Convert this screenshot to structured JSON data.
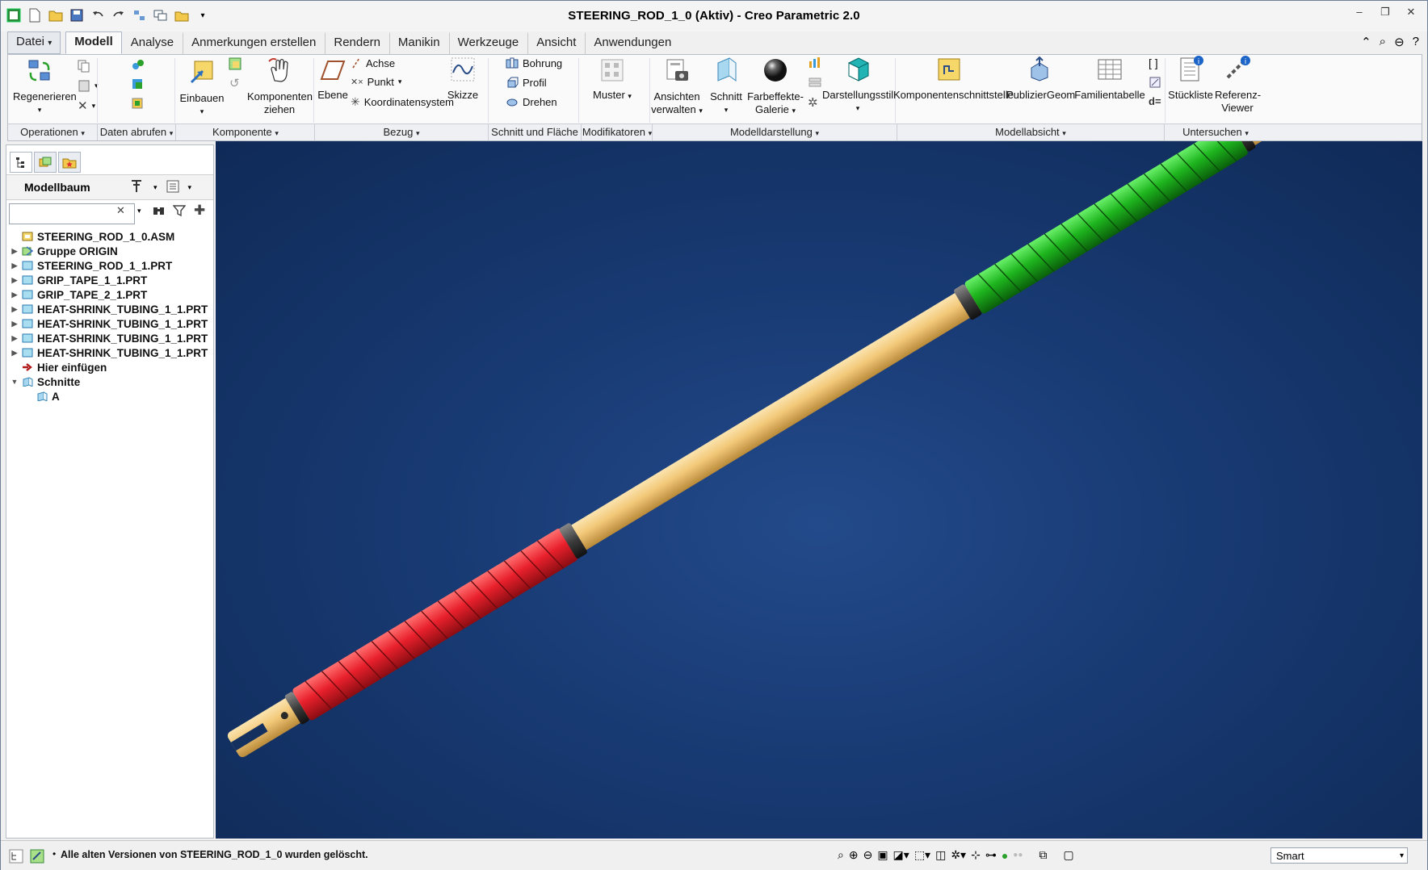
{
  "window": {
    "title": "STEERING_ROD_1_0 (Aktiv) - Creo Parametric 2.0"
  },
  "tabs": [
    {
      "label": "Datei"
    },
    {
      "label": "Modell"
    },
    {
      "label": "Analyse"
    },
    {
      "label": "Anmerkungen erstellen"
    },
    {
      "label": "Rendern"
    },
    {
      "label": "Manikin"
    },
    {
      "label": "Werkzeuge"
    },
    {
      "label": "Ansicht"
    },
    {
      "label": "Anwendungen"
    }
  ],
  "ribbon": {
    "buttons": {
      "regenerieren": "Regenerieren",
      "einbauen": "Einbauen",
      "komponenten_ziehen_1": "Komponenten",
      "komponenten_ziehen_2": "ziehen",
      "ebene": "Ebene",
      "achse": "Achse",
      "punkt": "Punkt",
      "koordinatensystem": "Koordinatensystem",
      "skizze": "Skizze",
      "bohrung": "Bohrung",
      "profil": "Profil",
      "drehen": "Drehen",
      "muster": "Muster",
      "ansichten_verwalten_1": "Ansichten",
      "ansichten_verwalten_2": "verwalten",
      "schnitt": "Schnitt",
      "farbeffekte_1": "Farbeffekte-",
      "farbeffekte_2": "Galerie",
      "darstellungsstil": "Darstellungsstil",
      "komponentenschnittstelle": "Komponentenschnittstelle",
      "publiziergeom": "PublizierGeom",
      "familientabelle": "Familientabelle",
      "stueckliste": "Stückliste",
      "referenz_viewer_1": "Referenz-",
      "referenz_viewer_2": "Viewer"
    },
    "groups": {
      "operationen": "Operationen",
      "daten_abrufen": "Daten abrufen",
      "komponente": "Komponente",
      "bezug": "Bezug",
      "schnitt_flaeche": "Schnitt und Fläche",
      "modifikatoren": "Modifikatoren",
      "modelldarstellung": "Modelldarstellung",
      "modellabsicht": "Modellabsicht",
      "untersuchen": "Untersuchen"
    },
    "dropdown_arrow": "▾"
  },
  "model_tree": {
    "title": "Modellbaum",
    "search_value": "",
    "items": [
      {
        "label": "STEERING_ROD_1_0.ASM",
        "toggle": ""
      },
      {
        "label": "Gruppe ORIGIN",
        "toggle": "▶"
      },
      {
        "label": "STEERING_ROD_1_1.PRT",
        "toggle": "▶"
      },
      {
        "label": "GRIP_TAPE_1_1.PRT",
        "toggle": "▶"
      },
      {
        "label": "GRIP_TAPE_2_1.PRT",
        "toggle": "▶"
      },
      {
        "label": "HEAT-SHRINK_TUBING_1_1.PRT",
        "toggle": "▶"
      },
      {
        "label": "HEAT-SHRINK_TUBING_1_1.PRT",
        "toggle": "▶"
      },
      {
        "label": "HEAT-SHRINK_TUBING_1_1.PRT",
        "toggle": "▶"
      },
      {
        "label": "HEAT-SHRINK_TUBING_1_1.PRT",
        "toggle": "▶"
      },
      {
        "label": "Hier einfügen",
        "toggle": ""
      },
      {
        "label": "Schnitte",
        "toggle": "▼"
      },
      {
        "label": "A",
        "toggle": ""
      }
    ]
  },
  "status": {
    "message": "Alle alten Versionen von STEERING_ROD_1_0 wurden gelöscht.",
    "filter_value": "Smart"
  },
  "colors": {
    "viewport_bg": "#183a73",
    "rod": "#f2c878",
    "grip_red": "#e8202c",
    "grip_green": "#1eb51e",
    "tubing": "#3c3c3c"
  }
}
